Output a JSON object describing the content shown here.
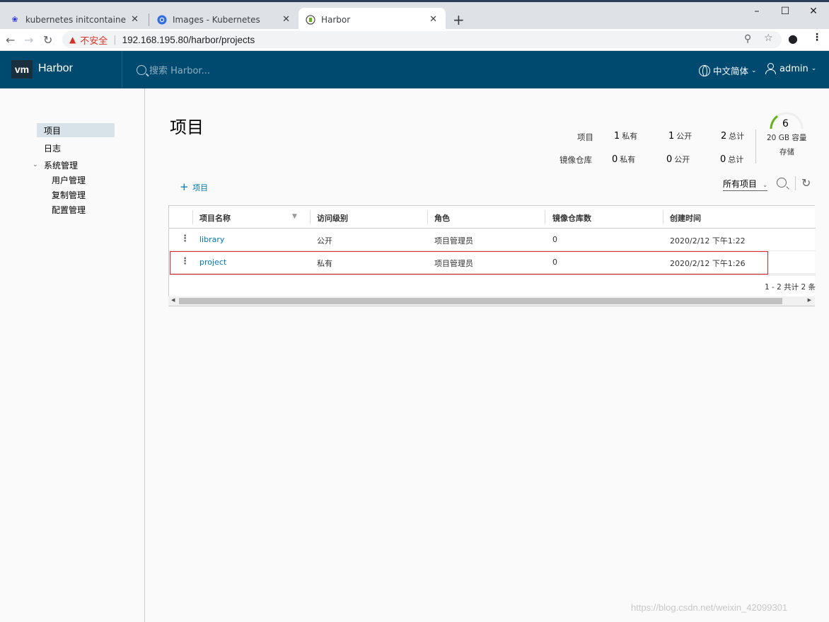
{
  "browser": {
    "tabs": [
      {
        "title": "kubernetes initcontainer_百度",
        "favicon": "baidu-paw-icon"
      },
      {
        "title": "Images - Kubernetes",
        "favicon": "kubernetes-icon"
      },
      {
        "title": "Harbor",
        "favicon": "harbor-icon"
      }
    ],
    "new_tab": "+",
    "security_label": "不安全",
    "url": "192.168.195.80/harbor/projects"
  },
  "header": {
    "logo": "vm",
    "brand": "Harbor",
    "search_placeholder": "搜索 Harbor...",
    "language": "中文简体",
    "user": "admin"
  },
  "sidebar": {
    "items": [
      {
        "label": "项目"
      },
      {
        "label": "日志"
      },
      {
        "label": "系统管理"
      },
      {
        "label": "用户管理"
      },
      {
        "label": "复制管理"
      },
      {
        "label": "配置管理"
      }
    ]
  },
  "main": {
    "title": "项目",
    "stats": {
      "projects_label": "项目",
      "repos_label": "镜像仓库",
      "projects": {
        "private_num": "1",
        "private": "私有",
        "public_num": "1",
        "public": "公开",
        "total_num": "2",
        "total": "总计"
      },
      "repos": {
        "private_num": "0",
        "private": "私有",
        "public_num": "0",
        "public": "公开",
        "total_num": "0",
        "total": "总计"
      },
      "storage_num": "6",
      "storage_capacity": "20 GB 容量",
      "storage_label": "存储",
      "storage_fraction": 0.3
    },
    "add_button": "项目",
    "filter": "所有项目",
    "table": {
      "columns": [
        "项目名称",
        "访问级别",
        "角色",
        "镜像仓库数",
        "创建时间"
      ],
      "rows": [
        {
          "name": "library",
          "access": "公开",
          "role": "项目管理员",
          "repos": "0",
          "created": "2020/2/12 下午1:22"
        },
        {
          "name": "project",
          "access": "私有",
          "role": "项目管理员",
          "repos": "0",
          "created": "2020/2/12 下午1:26"
        }
      ],
      "pagination": "1 - 2 共计 2 条"
    }
  },
  "watermark": "https://blog.csdn.net/weixin_42099301",
  "colors": {
    "header": "#004a70",
    "link": "#0079b8",
    "highlight": "#e0262b",
    "gauge": "#60b515"
  }
}
